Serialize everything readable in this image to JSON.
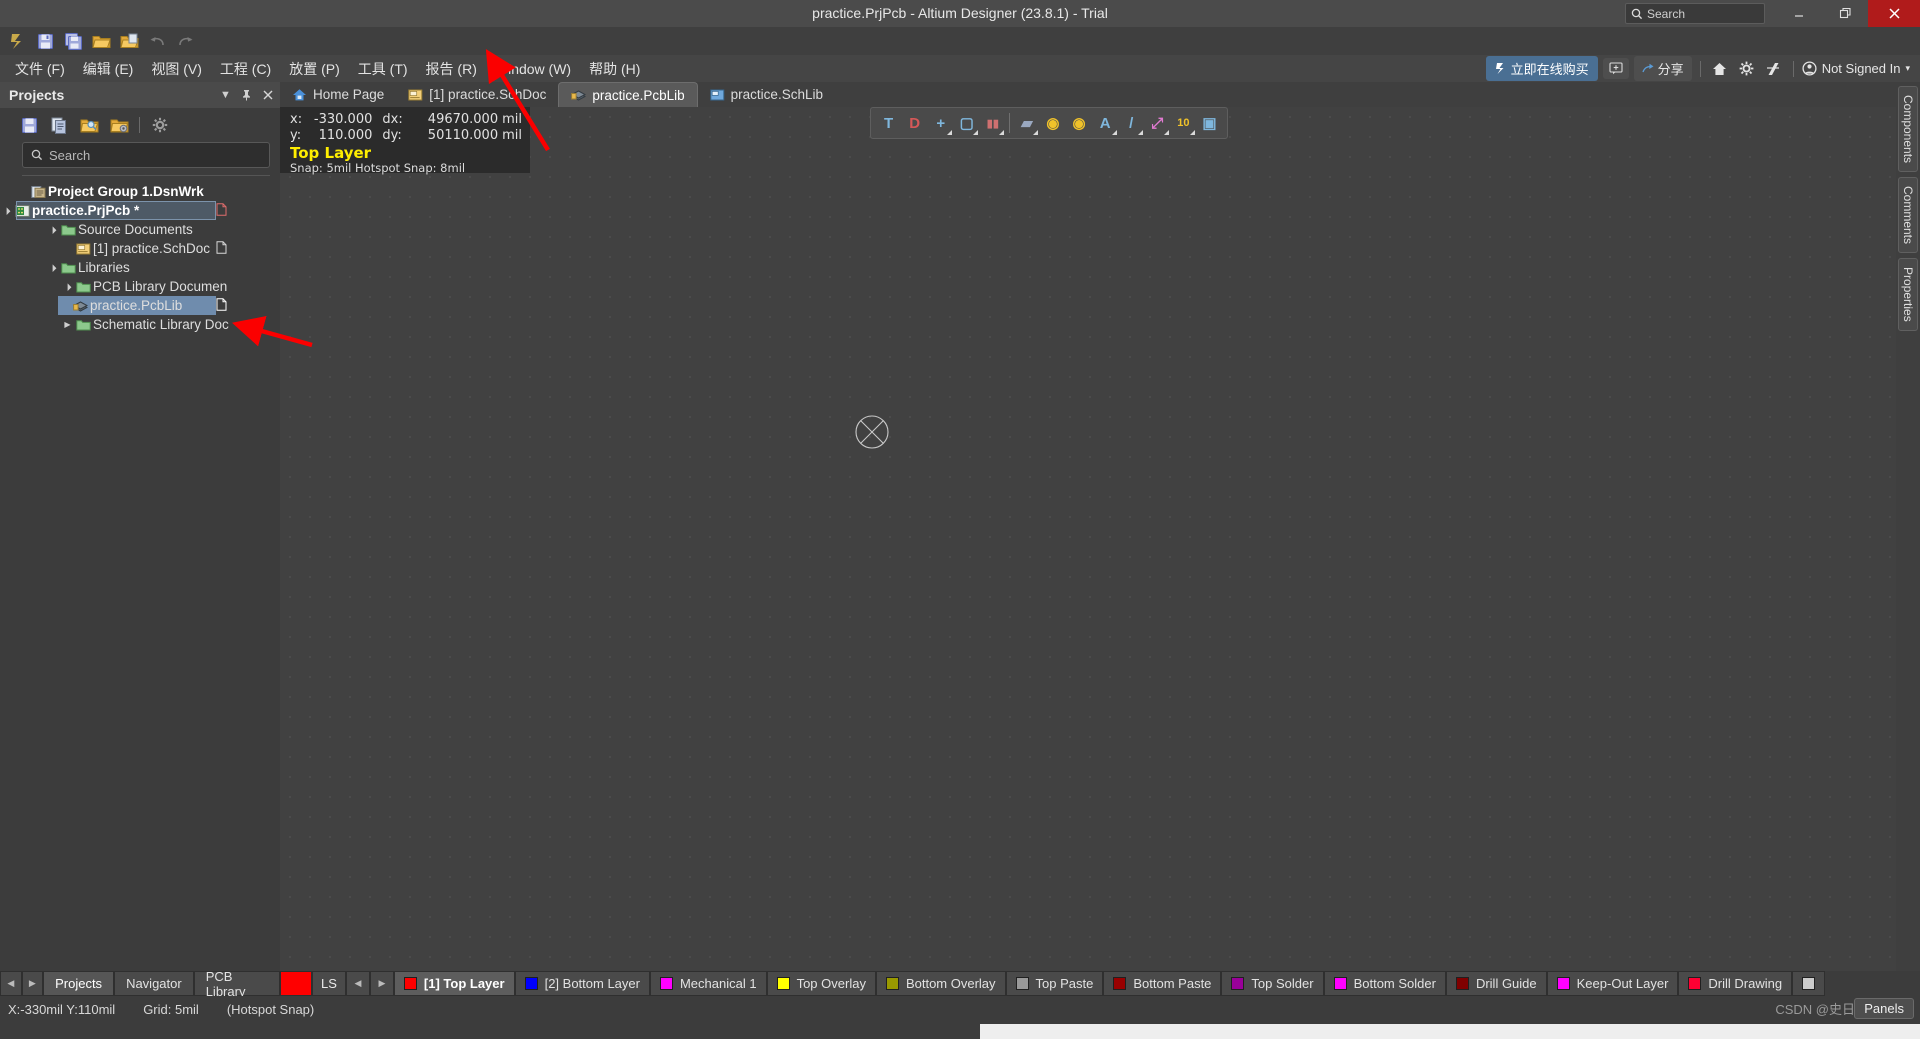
{
  "window": {
    "title": "practice.PrjPcb - Altium Designer (23.8.1) - Trial",
    "search_placeholder": "Search",
    "minimize": "–",
    "maximize": "❐",
    "close": "✕"
  },
  "quick_access": {
    "items": [
      {
        "name": "altium-logo-icon",
        "label": "A"
      },
      {
        "name": "save-icon",
        "label": "Save"
      },
      {
        "name": "save-all-icon",
        "label": "Save All"
      },
      {
        "name": "open-folder-icon",
        "label": "Open"
      },
      {
        "name": "open-project-icon",
        "label": "Open Project"
      },
      {
        "name": "undo-icon",
        "label": "Undo"
      },
      {
        "name": "redo-icon",
        "label": "Redo"
      }
    ]
  },
  "menubar": {
    "items": [
      {
        "label": "文件 (F)"
      },
      {
        "label": "编辑 (E)"
      },
      {
        "label": "视图 (V)"
      },
      {
        "label": "工程 (C)"
      },
      {
        "label": "放置 (P)"
      },
      {
        "label": "工具 (T)"
      },
      {
        "label": "报告 (R)"
      },
      {
        "label": "Window (W)"
      },
      {
        "label": "帮助 (H)"
      }
    ],
    "buy_online": "立即在线购买",
    "share": "分享",
    "sign_in": "Not Signed In",
    "sign_in_caret": "▾"
  },
  "projects_panel": {
    "title": "Projects",
    "collapse_caret": "▼",
    "pin": "📌",
    "close": "✕",
    "toolbar": [
      {
        "name": "save-icon"
      },
      {
        "name": "documents-icon"
      },
      {
        "name": "browse-folder-icon"
      },
      {
        "name": "configure-folder-icon"
      },
      {
        "name": "gear-icon"
      }
    ],
    "search_placeholder": "Search",
    "tree": [
      {
        "indent": 0,
        "twisty": "",
        "icon": "project-group-icon",
        "label": "Project Group 1.DsnWrk",
        "bold": true,
        "state": "none",
        "file_icon": false
      },
      {
        "indent": 1,
        "twisty": "▾",
        "icon": "pcb-project-icon",
        "label": "practice.PrjPcb *",
        "bold": true,
        "state": "sel-outline",
        "file_icon": true,
        "file_icon_color": "#e06c6c"
      },
      {
        "indent": 2,
        "twisty": "▾",
        "icon": "folder-icon",
        "label": "Source Documents",
        "bold": false,
        "state": "none",
        "file_icon": false
      },
      {
        "indent": 3,
        "twisty": "",
        "icon": "schdoc-icon",
        "label": "[1] practice.SchDoc",
        "bold": false,
        "state": "none",
        "file_icon": true,
        "file_icon_color": "#d8d8d8"
      },
      {
        "indent": 2,
        "twisty": "▾",
        "icon": "folder-icon",
        "label": "Libraries",
        "bold": false,
        "state": "none",
        "file_icon": false
      },
      {
        "indent": 3,
        "twisty": "▾",
        "icon": "folder-icon",
        "label": "PCB Library Documen",
        "bold": false,
        "state": "none",
        "file_icon": false
      },
      {
        "indent": 4,
        "twisty": "",
        "icon": "pcblib-icon",
        "label": "practice.PcbLib",
        "bold": false,
        "state": "sel-blue",
        "file_icon": true,
        "file_icon_color": "#ffffff"
      },
      {
        "indent": 3,
        "twisty": "▸",
        "icon": "folder-icon",
        "label": "Schematic Library Doc",
        "bold": false,
        "state": "none",
        "file_icon": false
      }
    ],
    "bottom_tabs": [
      {
        "label": "Projects",
        "active": true
      },
      {
        "label": "Navigator",
        "active": false
      },
      {
        "label": "PCB Library",
        "active": false
      }
    ],
    "nav_prev": "◀",
    "nav_next": "▶"
  },
  "doc_tabs": [
    {
      "label": "Home Page",
      "icon": "home-icon",
      "active": false
    },
    {
      "label": "[1] practice.SchDoc",
      "icon": "schdoc-icon",
      "active": false
    },
    {
      "label": "practice.PcbLib",
      "icon": "pcblib-icon",
      "active": true
    },
    {
      "label": "practice.SchLib",
      "icon": "schlib-icon",
      "active": false
    }
  ],
  "hud": {
    "x_key": "x:",
    "x_val": "-330.000",
    "y_key": "y:",
    "y_val": "110.000",
    "dx_key": "dx:",
    "dx_val": "49670.000",
    "dx_unit": "mil",
    "dy_key": "dy:",
    "dy_val": "50110.000",
    "dy_unit": "mil",
    "layer": "Top Layer",
    "layer_color": "#ffee00",
    "snap": "Snap: 5mil  Hotspot Snap: 8mil"
  },
  "pcb_toolbar": [
    {
      "name": "filter-icon",
      "glyph": "T",
      "color": "#7fb7dd",
      "dropdown": false
    },
    {
      "name": "magnet-snap-icon",
      "glyph": "D",
      "color": "#d55858",
      "dropdown": false
    },
    {
      "name": "place-crosshair-icon",
      "glyph": "+",
      "color": "#7fb7dd",
      "dropdown": true
    },
    {
      "name": "select-area-icon",
      "glyph": "▢",
      "color": "#7fb7dd",
      "dropdown": true
    },
    {
      "name": "align-icon",
      "glyph": "▮▮",
      "color": "#cf7070",
      "dropdown": true
    },
    {
      "name": "component-icon",
      "glyph": "▰",
      "color": "#9aa8c0",
      "dropdown": true
    },
    {
      "name": "pad-icon",
      "glyph": "◉",
      "color": "#f0c22a",
      "dropdown": false
    },
    {
      "name": "via-icon",
      "glyph": "◉",
      "color": "#f0c22a",
      "dropdown": false
    },
    {
      "name": "text-string-icon",
      "glyph": "A",
      "color": "#7fb7dd",
      "dropdown": true
    },
    {
      "name": "line-icon",
      "glyph": "/",
      "color": "#7fb7dd",
      "dropdown": true
    },
    {
      "name": "dimension-icon",
      "glyph": "⤢",
      "color": "#e07ad0",
      "dropdown": true
    },
    {
      "name": "measure-icon",
      "glyph": "10",
      "color": "#f0c22a",
      "dropdown": true
    },
    {
      "name": "board-region-icon",
      "glyph": "▣",
      "color": "#7fb7dd",
      "dropdown": false
    }
  ],
  "right_tabs": [
    {
      "label": "Components"
    },
    {
      "label": "Comments"
    },
    {
      "label": "Properties"
    }
  ],
  "layer_bar": {
    "ls_label": "LS",
    "ls_color": "#ff0000",
    "nav_prev": "◀",
    "nav_next": "▶",
    "layers": [
      {
        "label": "[1] Top Layer",
        "color": "#ff0000",
        "active": true
      },
      {
        "label": "[2] Bottom Layer",
        "color": "#0000ff",
        "active": false
      },
      {
        "label": "Mechanical 1",
        "color": "#ff00ff",
        "active": false
      },
      {
        "label": "Top Overlay",
        "color": "#ffff00",
        "active": false
      },
      {
        "label": "Bottom Overlay",
        "color": "#999900",
        "active": false
      },
      {
        "label": "Top Paste",
        "color": "#999999",
        "active": false
      },
      {
        "label": "Bottom Paste",
        "color": "#990000",
        "active": false
      },
      {
        "label": "Top Solder",
        "color": "#990099",
        "active": false
      },
      {
        "label": "Bottom Solder",
        "color": "#ff00ff",
        "active": false
      },
      {
        "label": "Drill Guide",
        "color": "#800000",
        "active": false
      },
      {
        "label": "Keep-Out Layer",
        "color": "#ff00ff",
        "active": false
      },
      {
        "label": "Drill Drawing",
        "color": "#ff0033",
        "active": false
      },
      {
        "label": "",
        "color": "#cccccc",
        "active": false
      }
    ]
  },
  "status_bar": {
    "coords": "X:-330mil Y:110mil",
    "grid": "Grid: 5mil",
    "snap_mode": "(Hotspot Snap)",
    "watermark": "CSDN @史日日",
    "panels": "Panels"
  }
}
